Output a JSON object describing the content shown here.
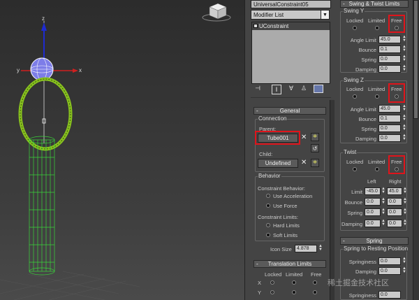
{
  "viewport": {
    "axis_x": "x",
    "axis_z": "z"
  },
  "object_name": "UniversalConstraint05",
  "modifier_list": {
    "label": "Modifier List"
  },
  "stack": {
    "item": "UConstraint"
  },
  "general": {
    "title": "General",
    "connection": "Connection",
    "parent_label": "Parent:",
    "parent_value": "Tube001",
    "child_label": "Child:",
    "child_value": "Undefined",
    "behavior": "Behavior",
    "constraint_behavior": "Constraint Behavior:",
    "use_acceleration": "Use Acceleration",
    "use_force": "Use Force",
    "constraint_limits": "Constraint Limits:",
    "hard_limits": "Hard Limits",
    "soft_limits": "Soft Limits",
    "icon_size_label": "Icon Size",
    "icon_size_value": "4.878"
  },
  "translation_limits": {
    "title": "Translation Limits",
    "locked": "Locked",
    "limited": "Limited",
    "free": "Free",
    "x": "X",
    "y": "Y"
  },
  "swing_twist": {
    "title": "Swing & Twist Limits",
    "swing_y": {
      "title": "Swing Y",
      "locked": "Locked",
      "limited": "Limited",
      "free": "Free",
      "angle_limit_label": "Angle Limit",
      "angle_limit": "45.0",
      "bounce_label": "Bounce",
      "bounce": "0.1",
      "spring_label": "Spring",
      "spring": "0.0",
      "damping_label": "Damping",
      "damping": "0.0"
    },
    "swing_z": {
      "title": "Swing Z",
      "locked": "Locked",
      "limited": "Limited",
      "free": "Free",
      "angle_limit_label": "Angle Limit",
      "angle_limit": "45.0",
      "bounce_label": "Bounce",
      "bounce": "0.1",
      "spring_label": "Spring",
      "spring": "0.0",
      "damping_label": "Damping",
      "damping": "0.0"
    },
    "twist": {
      "title": "Twist",
      "locked": "Locked",
      "limited": "Limited",
      "free": "Free",
      "left": "Left",
      "right": "Right",
      "limit_label": "Limit",
      "limit_left": "-45.0",
      "limit_right": "45.0",
      "bounce_label": "Bounce",
      "bounce_left": "0.0",
      "bounce_right": "0.0",
      "spring_label": "Spring",
      "spring_left": "0.0",
      "spring_right": "0.0",
      "damping_label": "Damping",
      "damping_left": "0.0",
      "damping_right": "0.0"
    }
  },
  "spring": {
    "title": "Spring",
    "resting": "Spring to Resting Position",
    "springiness_label": "Springiness",
    "springiness": "0.0",
    "damping_label": "Damping",
    "damping": "0.0",
    "springiness2": "0.0"
  },
  "watermark": "稀土掘金技术社区",
  "colors": {
    "highlight": "#e0141b",
    "wire": "#39d639",
    "ring": "#88c21e"
  }
}
